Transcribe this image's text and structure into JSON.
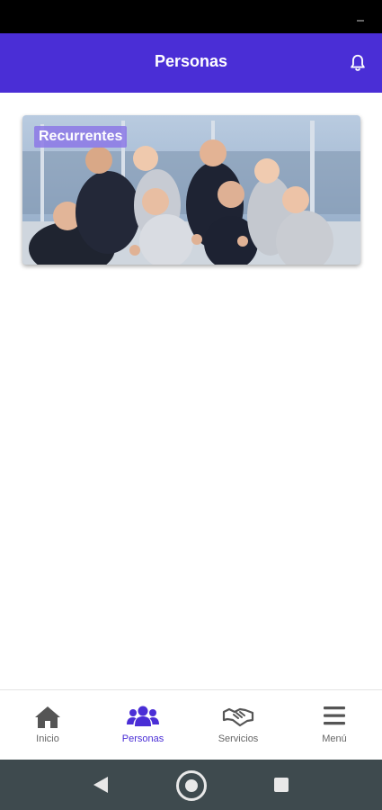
{
  "app_bar": {
    "title": "Personas",
    "accent_color": "#4a2ed6",
    "action_icon": "bell-icon"
  },
  "cards": [
    {
      "label": "Recurrentes",
      "image": "business-team-thumbs-up-photo"
    }
  ],
  "bottom_nav": {
    "items": [
      {
        "label": "Inicio",
        "icon": "home-icon",
        "active": false
      },
      {
        "label": "Personas",
        "icon": "people-icon",
        "active": true
      },
      {
        "label": "Servicios",
        "icon": "handshake-icon",
        "active": false
      },
      {
        "label": "Menú",
        "icon": "hamburger-icon",
        "active": false
      }
    ]
  },
  "system_nav": {
    "buttons": [
      "back-icon",
      "home-circle-icon",
      "recents-icon"
    ]
  }
}
